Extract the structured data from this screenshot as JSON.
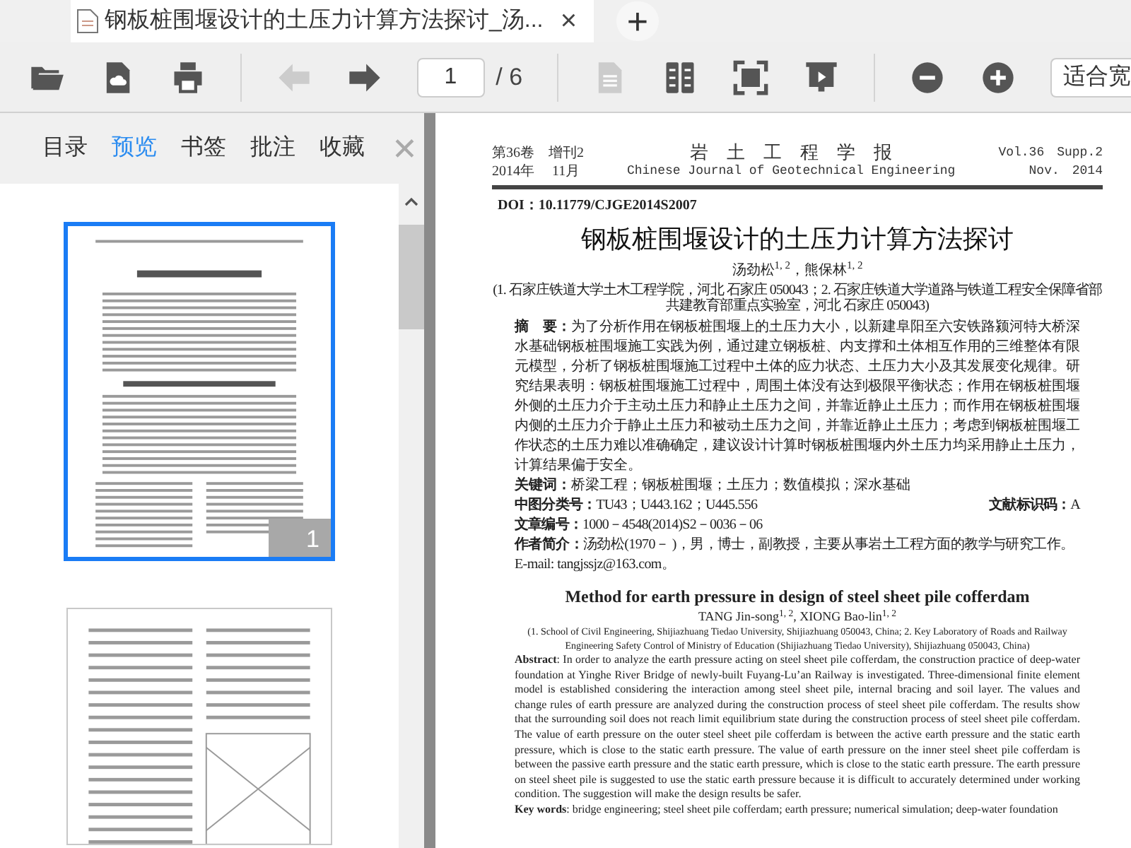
{
  "tab": {
    "title": "钢板桩围堰设计的土压力计算方法探讨_汤...",
    "close": "×",
    "new_tab": "+"
  },
  "toolbar": {
    "groups": [
      {
        "buttons": [
          {
            "kind": "open",
            "disabled": false
          },
          {
            "kind": "cloud",
            "disabled": false
          },
          {
            "kind": "print",
            "disabled": false
          }
        ]
      },
      {
        "buttons": [
          {
            "kind": "back",
            "disabled": true
          },
          {
            "kind": "forward",
            "disabled": false
          }
        ]
      },
      {
        "buttons": [
          {
            "kind": "single",
            "disabled": true
          },
          {
            "kind": "double",
            "disabled": false
          },
          {
            "kind": "fit",
            "disabled": false
          },
          {
            "kind": "present",
            "disabled": false
          }
        ]
      },
      {
        "buttons": [
          {
            "kind": "zoomout",
            "disabled": false
          },
          {
            "kind": "zoomin",
            "disabled": false
          }
        ]
      }
    ],
    "page_value": "1",
    "page_total": "/ 6",
    "zoom_value": "适合宽"
  },
  "sidebar": {
    "tabs": [
      {
        "label": "目录",
        "selected": false
      },
      {
        "label": "预览",
        "selected": true
      },
      {
        "label": "书签",
        "selected": false
      },
      {
        "label": "批注",
        "selected": false
      },
      {
        "label": "收藏",
        "selected": false
      }
    ],
    "close": "✕",
    "thumbnails": [
      {
        "selected": true,
        "number": "1"
      },
      {
        "selected": false
      }
    ]
  },
  "document": {
    "header_left": [
      "第36卷　增刊2",
      "2014年　 11月"
    ],
    "header_center": [
      "岩　土　工　程　学　报",
      "Chinese Journal of Geotechnical Engineering"
    ],
    "header_right": [
      "Vol.36　Supp.2",
      "Nov.　2014"
    ],
    "doi": "DOI：10.11779/CJGE2014S2007",
    "title": "钢板桩围堰设计的土压力计算方法探讨",
    "authors": "汤劲松$^{1, 2}$，熊保林$^{1, 2}$",
    "affiliation": "(1. 石家庄铁道大学土木工程学院，河北 石家庄 050043；2. 石家庄铁道大学道路与铁道工程安全保障省部共建教育部重点实验室，河北 石家庄 050043)",
    "abstract": "**摘　要：**为了分析作用在钢板桩围堰上的土压力大小，以新建阜阳至六安铁路颍河特大桥深水基础钢板桩围堰施工实践为例，通过建立钢板桩、内支撑和土体相互作用的三维整体有限元模型，分析了钢板桩围堰施工过程中土体的应力状态、土压力大小及其发展变化规律。研究结果表明：钢板桩围堰施工过程中，周围土体没有达到极限平衡状态；作用在钢板桩围堰外侧的土压力介于主动土压力和静止土压力之间，并靠近静止土压力；而作用在钢板桩围堰内侧的土压力介于静止土压力和被动土压力之间，并靠近静止土压力；考虑到钢板桩围堰工作状态的土压力难以准确确定，建议设计计算时钢板桩围堰内外土压力均采用静止土压力，计算结果偏于安全。",
    "keywords": "**关键词：**桥梁工程；钢板桩围堰；土压力；数值模拟；深水基础",
    "meta": [
      "**中图分类号：**TU43；U443.162；U445.556",
      "**文献标识码：**A",
      "**文章编号：**1000－4548(2014)S2－0036－06"
    ],
    "author_info": "**作者简介：**汤劲松(1970－ )，男，博士，副教授，主要从事岩土工程方面的教学与研究工作。E-mail: tangjssjz@163.com。",
    "en_title": "Method for earth pressure in design of steel sheet pile cofferdam",
    "en_authors": "TANG Jin-song$^{1, 2}$, XIONG Bao-lin$^{1, 2}$",
    "en_affiliation": "(1. School of Civil Engineering, Shijiazhuang Tiedao University, Shijiazhuang 050043, China; 2. Key Laboratory of Roads and Railway Engineering Safety Control of Ministry of Education (Shijiazhuang Tiedao University), Shijiazhuang 050043, China)",
    "en_abstract": "**Abstract**: In order to analyze the earth pressure acting on steel sheet pile cofferdam, the construction practice of deep-water foundation at Yinghe River Bridge of newly-built Fuyang-Lu’an Railway is investigated. Three-dimensional finite element model is established considering the interaction among steel sheet pile, internal bracing and soil layer. The values and change rules of earth pressure are analyzed during the construction process of steel sheet pile cofferdam. The results show that the surrounding soil does not reach limit equilibrium state during the construction process of steel sheet pile cofferdam. The value of earth pressure on the outer steel sheet pile cofferdam is between the active earth pressure and the static earth pressure, which is close to the static earth pressure. The value of earth pressure on the inner steel sheet pile cofferdam is between the passive earth pressure and the static earth pressure, which is close to the static earth pressure. The earth pressure on steel sheet pile is suggested to use the static earth pressure because it is difficult to accurately determined under working condition. The suggestion will make the design results be safer.",
    "en_keywords": "**Key words**: bridge engineering; steel sheet pile cofferdam; earth pressure; numerical simulation; deep-water foundation"
  }
}
